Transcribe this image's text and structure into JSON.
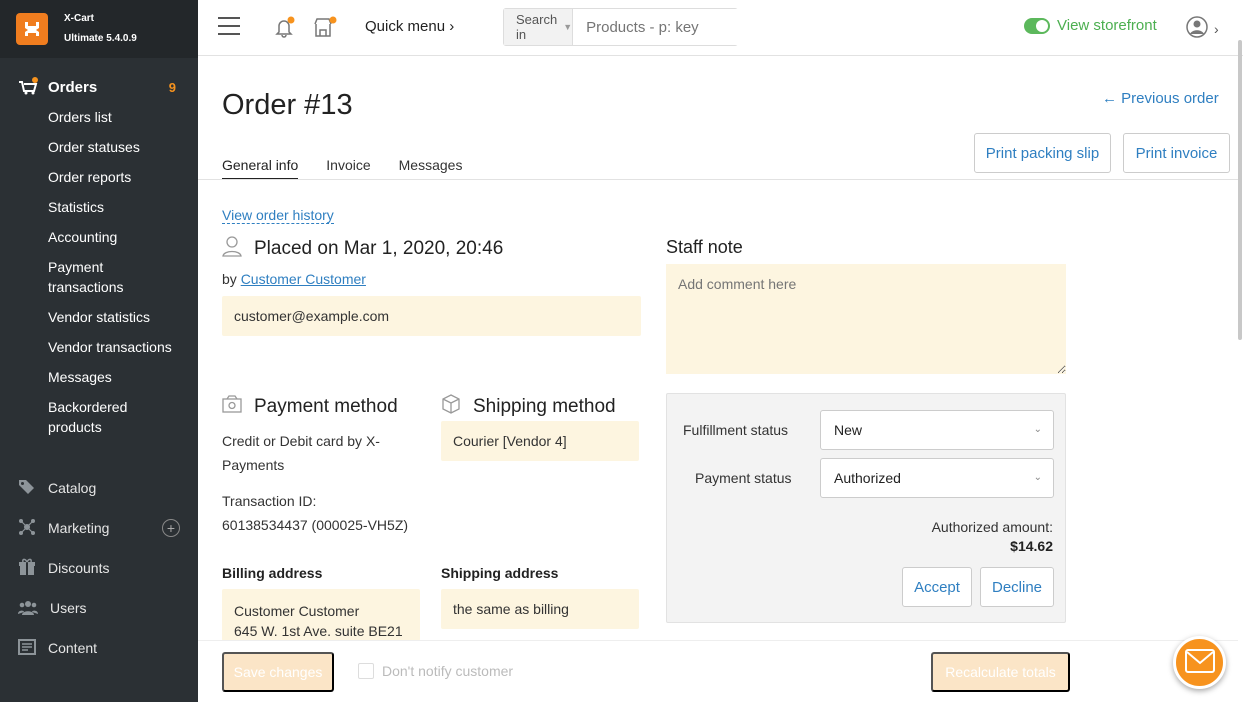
{
  "brand": {
    "name": "X-Cart",
    "edition": "Ultimate 5.4.0.9"
  },
  "sidebar": {
    "orders": {
      "label": "Orders",
      "count": "9"
    },
    "orders_sub": [
      "Orders list",
      "Order statuses",
      "Order reports",
      "Statistics",
      "Accounting",
      "Payment transactions",
      "Vendor statistics",
      "Vendor transactions",
      "Messages",
      "Backordered products"
    ],
    "items": [
      {
        "label": "Catalog",
        "icon": "tag-icon"
      },
      {
        "label": "Marketing",
        "icon": "marketing-icon"
      },
      {
        "label": "Discounts",
        "icon": "gift-icon"
      },
      {
        "label": "Users",
        "icon": "users-icon"
      },
      {
        "label": "Content",
        "icon": "content-icon"
      }
    ],
    "colors": {
      "bg": "#2b3034",
      "accent": "#f7931e"
    }
  },
  "header": {
    "quick_menu": "Quick menu ›",
    "search_in": "Search in",
    "search_placeholder": "Products - p: key",
    "view_storefront": "View storefront"
  },
  "page": {
    "title": "Order #13",
    "previous_order": "← Previous order",
    "print_packing_slip": "Print packing slip",
    "print_invoice": "Print invoice",
    "tabs": [
      "General info",
      "Invoice",
      "Messages"
    ]
  },
  "order": {
    "view_history": "View order history",
    "placed_on": "Placed on Mar 1, 2020, 20:46",
    "by_prefix": "by",
    "customer_name": "Customer Customer",
    "email": "customer@example.com",
    "payment_heading": "Payment method",
    "payment_method": "Credit or Debit card by X-Payments",
    "transaction_label": "Transaction ID:",
    "transaction_id": "60138534437 (000025-VH5Z)",
    "shipping_heading": "Shipping method",
    "shipping_method": "Courier [Vendor 4]",
    "billing_heading": "Billing address",
    "billing_name": "Customer Customer",
    "billing_line1": "645 W. 1st Ave. suite BE21",
    "shipping_addr_heading": "Shipping address",
    "shipping_addr": "the same as billing"
  },
  "staff": {
    "heading": "Staff note",
    "placeholder": "Add comment here"
  },
  "status": {
    "fulfillment_label": "Fulfillment status",
    "fulfillment_value": "New",
    "payment_label": "Payment status",
    "payment_value": "Authorized",
    "authorized_label": "Authorized amount:",
    "authorized_value": "$14.62",
    "accept": "Accept",
    "decline": "Decline"
  },
  "footer": {
    "save": "Save changes",
    "notify": "Don't notify customer",
    "recalculate": "Recalculate totals"
  }
}
